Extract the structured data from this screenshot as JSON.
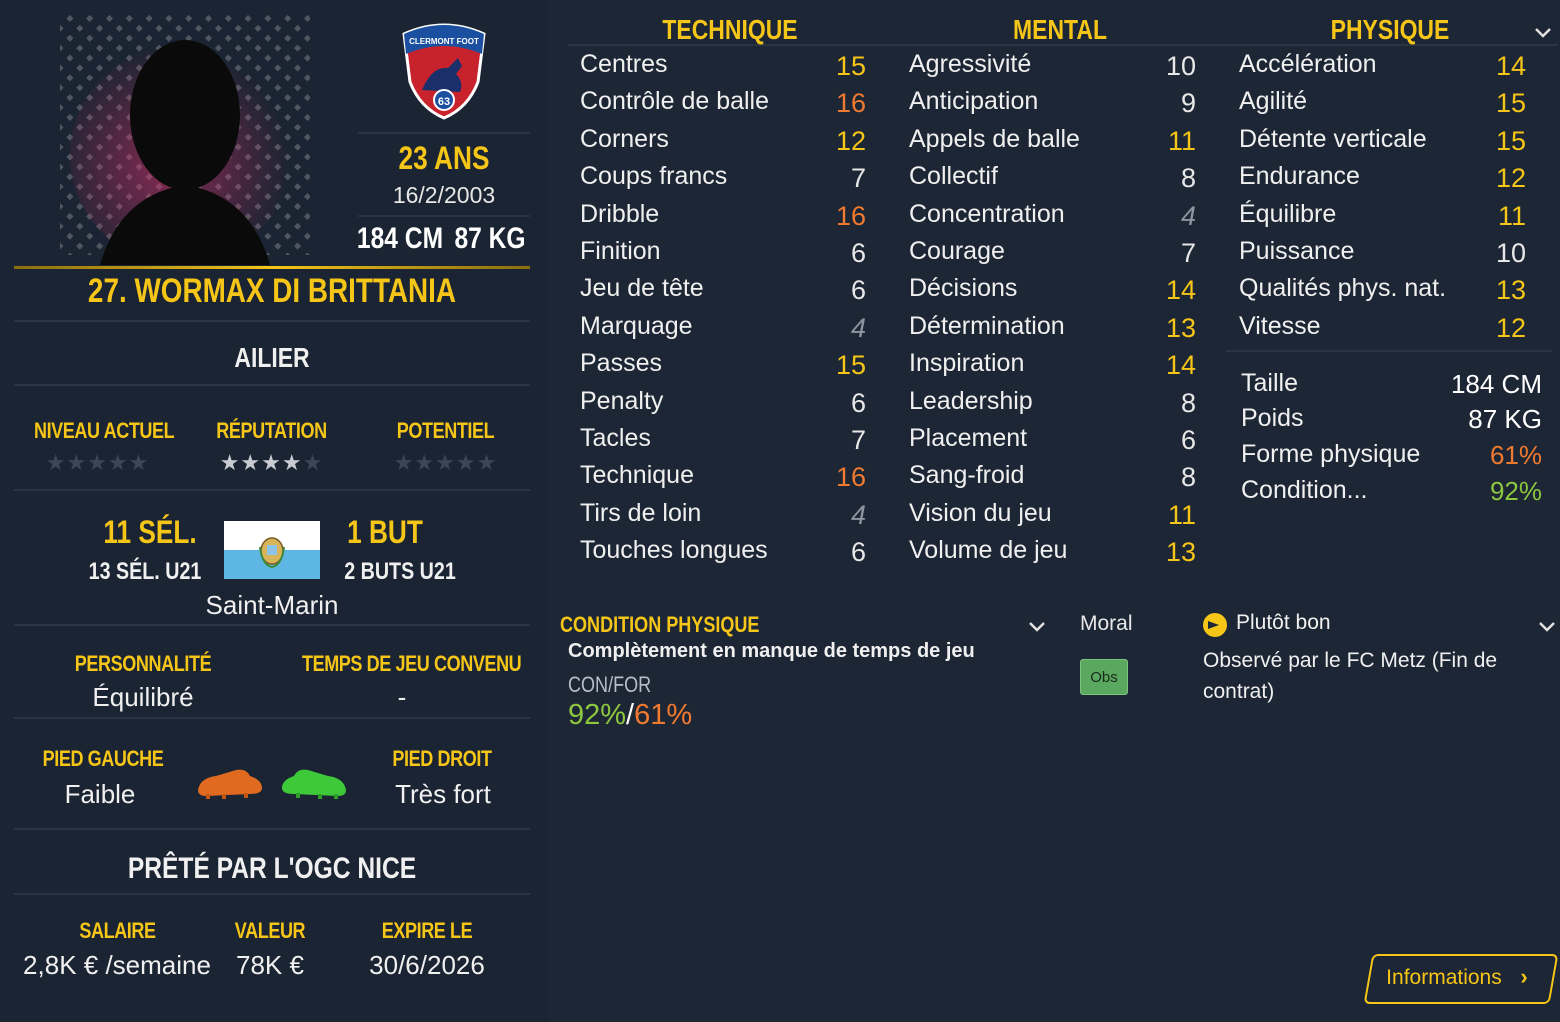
{
  "player": {
    "age": "23 ANS",
    "dob": "16/2/2003",
    "height": "184 CM",
    "weight": "87 KG",
    "name": "27. WORMAX DI BRITTANIA",
    "position": "AILIER"
  },
  "club": {
    "badge_top": "CLERMONT FOOT",
    "badge_num": "63"
  },
  "ratings": {
    "current_label": "NIVEAU ACTUEL",
    "current_stars": 0,
    "reputation_label": "RÉPUTATION",
    "reputation_stars": 4,
    "potential_label": "POTENTIEL",
    "potential_stars": 0
  },
  "international": {
    "caps": "11 SÉL.",
    "caps_u21": "13 SÉL. U21",
    "goals": "1 BUT",
    "goals_u21": "2 BUTS U21",
    "nation": "Saint-Marin"
  },
  "personality": {
    "label": "PERSONNALITÉ",
    "value": "Équilibré",
    "playtime_label": "TEMPS DE JEU CONVENU",
    "playtime_value": "-"
  },
  "feet": {
    "left_label": "PIED GAUCHE",
    "left_value": "Faible",
    "right_label": "PIED DROIT",
    "right_value": "Très fort"
  },
  "loan": "PRÊTÉ PAR L'OGC NICE",
  "contract": {
    "salary_label": "SALAIRE",
    "salary": "2,8K € /semaine",
    "value_label": "VALEUR",
    "value": "78K €",
    "expiry_label": "EXPIRE LE",
    "expiry": "30/6/2026"
  },
  "technique": {
    "title": "TECHNIQUE",
    "items": [
      {
        "name": "Centres",
        "value": "15",
        "tone": "yellow"
      },
      {
        "name": "Contrôle de balle",
        "value": "16",
        "tone": "orange"
      },
      {
        "name": "Corners",
        "value": "12",
        "tone": "yellow"
      },
      {
        "name": "Coups francs",
        "value": "7",
        "tone": "white"
      },
      {
        "name": "Dribble",
        "value": "16",
        "tone": "orange"
      },
      {
        "name": "Finition",
        "value": "6",
        "tone": "white"
      },
      {
        "name": "Jeu de tête",
        "value": "6",
        "tone": "white"
      },
      {
        "name": "Marquage",
        "value": "4",
        "tone": "grey"
      },
      {
        "name": "Passes",
        "value": "15",
        "tone": "yellow"
      },
      {
        "name": "Penalty",
        "value": "6",
        "tone": "white"
      },
      {
        "name": "Tacles",
        "value": "7",
        "tone": "white"
      },
      {
        "name": "Technique",
        "value": "16",
        "tone": "orange"
      },
      {
        "name": "Tirs de loin",
        "value": "4",
        "tone": "grey"
      },
      {
        "name": "Touches longues",
        "value": "6",
        "tone": "white"
      }
    ]
  },
  "mental": {
    "title": "MENTAL",
    "items": [
      {
        "name": "Agressivité",
        "value": "10",
        "tone": "white"
      },
      {
        "name": "Anticipation",
        "value": "9",
        "tone": "white"
      },
      {
        "name": "Appels de balle",
        "value": "11",
        "tone": "yellow"
      },
      {
        "name": "Collectif",
        "value": "8",
        "tone": "white"
      },
      {
        "name": "Concentration",
        "value": "4",
        "tone": "grey"
      },
      {
        "name": "Courage",
        "value": "7",
        "tone": "white"
      },
      {
        "name": "Décisions",
        "value": "14",
        "tone": "yellow"
      },
      {
        "name": "Détermination",
        "value": "13",
        "tone": "yellow"
      },
      {
        "name": "Inspiration",
        "value": "14",
        "tone": "yellow"
      },
      {
        "name": "Leadership",
        "value": "8",
        "tone": "white"
      },
      {
        "name": "Placement",
        "value": "6",
        "tone": "white"
      },
      {
        "name": "Sang-froid",
        "value": "8",
        "tone": "white"
      },
      {
        "name": "Vision du jeu",
        "value": "11",
        "tone": "yellow"
      },
      {
        "name": "Volume de jeu",
        "value": "13",
        "tone": "yellow"
      }
    ]
  },
  "physique": {
    "title": "PHYSIQUE",
    "items": [
      {
        "name": "Accélération",
        "value": "14",
        "tone": "yellow"
      },
      {
        "name": "Agilité",
        "value": "15",
        "tone": "yellow"
      },
      {
        "name": "Détente verticale",
        "value": "15",
        "tone": "yellow"
      },
      {
        "name": "Endurance",
        "value": "12",
        "tone": "yellow"
      },
      {
        "name": "Équilibre",
        "value": "11",
        "tone": "yellow"
      },
      {
        "name": "Puissance",
        "value": "10",
        "tone": "white"
      },
      {
        "name": "Qualités phys. nat.",
        "value": "13",
        "tone": "yellow"
      },
      {
        "name": "Vitesse",
        "value": "12",
        "tone": "yellow"
      }
    ]
  },
  "body": {
    "height_label": "Taille",
    "height": "184 CM",
    "weight_label": "Poids",
    "weight": "87 KG",
    "form_label": "Forme physique",
    "form": "61%",
    "condition_label": "Condition...",
    "condition": "92%"
  },
  "fitness": {
    "title": "CONDITION PHYSIQUE",
    "status": "Complètement en manque de temps de jeu",
    "ratio_label": "CON/FOR",
    "con": "92%",
    "slash": "/",
    "for": "61%"
  },
  "morale": {
    "label": "Moral",
    "badge": "Obs",
    "value": "Plutôt bon",
    "note": "Observé par le FC Metz (Fin de contrat)"
  },
  "info_button": "Informations",
  "colors": {
    "accent": "#f5c518",
    "orange": "#ef7a30",
    "green": "#8dc63f",
    "bg": "#1c2533"
  }
}
